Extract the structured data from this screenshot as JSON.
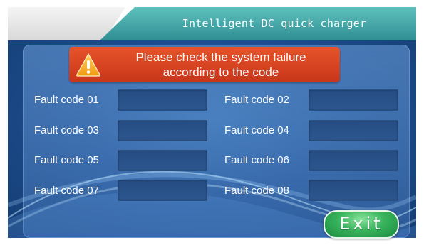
{
  "header": {
    "title": "Intelligent DC quick charger"
  },
  "alert": {
    "message_line1": "Please check the system failure",
    "message_line2": "according to the code",
    "icon": "warning-triangle-icon"
  },
  "faults": [
    {
      "label": "Fault code 01",
      "value": ""
    },
    {
      "label": "Fault code 02",
      "value": ""
    },
    {
      "label": "Fault code 03",
      "value": ""
    },
    {
      "label": "Fault code 04",
      "value": ""
    },
    {
      "label": "Fault code 05",
      "value": ""
    },
    {
      "label": "Fault code 06",
      "value": ""
    },
    {
      "label": "Fault code 07",
      "value": ""
    },
    {
      "label": "Fault code 08",
      "value": ""
    }
  ],
  "actions": {
    "exit_label": "Exit"
  },
  "colors": {
    "header_teal": "#3aa3a3",
    "background_blue": "#1e4f8f",
    "alert_red": "#d8431f",
    "exit_green": "#38b45c"
  }
}
